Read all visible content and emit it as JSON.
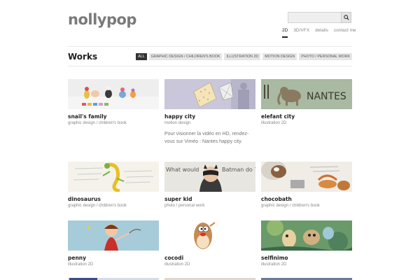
{
  "site": {
    "logo": "nollypop"
  },
  "search": {
    "value": "",
    "placeholder": "",
    "icon": "search-icon"
  },
  "nav": {
    "items": [
      "2D",
      "3D/VFX",
      "details",
      "contact me"
    ],
    "active": "2D"
  },
  "section": {
    "title": "Works"
  },
  "filters": {
    "items": [
      "ALL",
      "GRAPHIC DESIGN / CHILDREN'S BOOK",
      "ILLUSTRATION 2D",
      "MOTION DESIGN",
      "PHOTO / PERSONAL WORK"
    ],
    "active": "ALL"
  },
  "cards": [
    {
      "title": "snail's family",
      "category": "graphic design / children's book"
    },
    {
      "title": "happy city",
      "category": "motion design",
      "description": "Pour visionner la vidéo en HD, rendez-vous sur Viméo : Nantes happy city."
    },
    {
      "title": "elefant city",
      "category": "illustration 2D",
      "image_text": "NANTES"
    },
    {
      "title": "dinosaurus",
      "category": "graphic design / children's book"
    },
    {
      "title": "super kid",
      "category": "photo / personal work",
      "image_text": [
        "What would",
        "Batman do ?"
      ]
    },
    {
      "title": "chocobath",
      "category": "graphic design / children's book"
    },
    {
      "title": "penny",
      "category": "illustration 2D"
    },
    {
      "title": "cocodi",
      "category": "illustration 2D"
    },
    {
      "title": "selfinimo",
      "category": "illustration 2D"
    }
  ],
  "colors": {
    "accent": "#222222",
    "text": "#444444",
    "muted": "#888888",
    "filter_bg": "#e6e6e6"
  }
}
